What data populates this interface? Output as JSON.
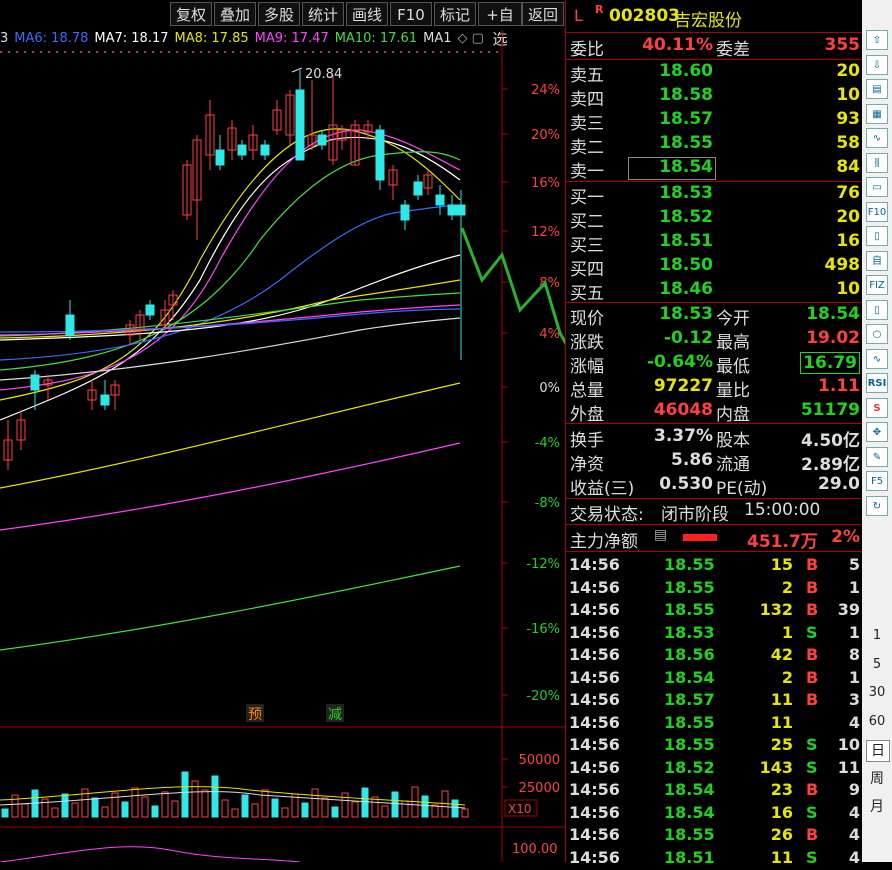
{
  "toolbar": {
    "buttons": [
      "复权",
      "叠加",
      "多股",
      "统计",
      "画线",
      "F10",
      "标记",
      "+自选",
      "返回"
    ]
  },
  "ma_bar": {
    "cut_prefix": "3",
    "items": [
      {
        "label": "MA6: 18.78",
        "color": "#3a6bff"
      },
      {
        "label": "MA7: 18.17",
        "color": "#ffffff"
      },
      {
        "label": "MA8: 17.85",
        "color": "#e6e600"
      },
      {
        "label": "MA9: 17.47",
        "color": "#ff44ff"
      },
      {
        "label": "MA10: 17.61",
        "color": "#44dd44"
      },
      {
        "label": "MA1",
        "color": "#dddddd"
      }
    ]
  },
  "chart": {
    "high_label": "20.84",
    "pct_ticks": [
      "24%",
      "20%",
      "16%",
      "12%",
      "8%",
      "4%",
      "0%",
      "-4%",
      "-8%",
      "-12%",
      "-16%",
      "-20%"
    ],
    "markers": [
      "预",
      "减"
    ],
    "volume_ticks": [
      "50000",
      "25000"
    ],
    "volume_multiplier": "X10",
    "indicator_tick": "100.00"
  },
  "quote": {
    "header": {
      "prefix": "L",
      "badge": "R",
      "code": "002803",
      "name": "吉宏股份"
    },
    "ratio": {
      "label": "委比",
      "value": "40.11%",
      "label2": "委差",
      "value2": "355"
    },
    "asks": [
      {
        "label": "卖五",
        "price": "18.60",
        "vol": "20"
      },
      {
        "label": "卖四",
        "price": "18.58",
        "vol": "10"
      },
      {
        "label": "卖三",
        "price": "18.57",
        "vol": "93"
      },
      {
        "label": "卖二",
        "price": "18.55",
        "vol": "58"
      },
      {
        "label": "卖一",
        "price": "18.54",
        "vol": "84"
      }
    ],
    "bids": [
      {
        "label": "买一",
        "price": "18.53",
        "vol": "76"
      },
      {
        "label": "买二",
        "price": "18.52",
        "vol": "20"
      },
      {
        "label": "买三",
        "price": "18.51",
        "vol": "16"
      },
      {
        "label": "买四",
        "price": "18.50",
        "vol": "498"
      },
      {
        "label": "买五",
        "price": "18.46",
        "vol": "10"
      }
    ],
    "stats": [
      {
        "l1": "现价",
        "v1": "18.53",
        "c1": "g",
        "l2": "今开",
        "v2": "18.54",
        "c2": "g"
      },
      {
        "l1": "涨跌",
        "v1": "-0.12",
        "c1": "g",
        "l2": "最高",
        "v2": "19.02",
        "c2": "r"
      },
      {
        "l1": "涨幅",
        "v1": "-0.64%",
        "c1": "g",
        "l2": "最低",
        "v2": "16.79",
        "c2": "g"
      },
      {
        "l1": "总量",
        "v1": "97227",
        "c1": "y",
        "l2": "量比",
        "v2": "1.11",
        "c2": "r"
      },
      {
        "l1": "外盘",
        "v1": "46048",
        "c1": "r",
        "l2": "内盘",
        "v2": "51179",
        "c2": "g"
      }
    ],
    "fundamentals": [
      {
        "l1": "换手",
        "v1": "3.37%",
        "l2": "股本",
        "v2": "4.50亿"
      },
      {
        "l1": "净资",
        "v1": "5.86",
        "l2": "流通",
        "v2": "2.89亿"
      },
      {
        "l1": "收益(三)",
        "v1": "0.530",
        "l2": "PE(动)",
        "v2": "29.0"
      }
    ],
    "trade_status": {
      "label": "交易状态:",
      "value": "闭市阶段",
      "time": "15:00:00"
    },
    "main_flow": {
      "label": "主力净额",
      "value": "451.7万",
      "pct": "2%"
    },
    "ticks": [
      {
        "t": "14:56",
        "p": "18.55",
        "v": "15",
        "s": "B",
        "n": "5"
      },
      {
        "t": "14:56",
        "p": "18.55",
        "v": "2",
        "s": "B",
        "n": "1"
      },
      {
        "t": "14:56",
        "p": "18.55",
        "v": "132",
        "s": "B",
        "n": "39"
      },
      {
        "t": "14:56",
        "p": "18.53",
        "v": "1",
        "s": "S",
        "n": "1"
      },
      {
        "t": "14:56",
        "p": "18.56",
        "v": "42",
        "s": "B",
        "n": "8"
      },
      {
        "t": "14:56",
        "p": "18.54",
        "v": "2",
        "s": "B",
        "n": "1"
      },
      {
        "t": "14:56",
        "p": "18.57",
        "v": "11",
        "s": "B",
        "n": "3"
      },
      {
        "t": "14:56",
        "p": "18.55",
        "v": "11",
        "s": "",
        "n": "4"
      },
      {
        "t": "14:56",
        "p": "18.55",
        "v": "25",
        "s": "S",
        "n": "10"
      },
      {
        "t": "14:56",
        "p": "18.52",
        "v": "143",
        "s": "S",
        "n": "11"
      },
      {
        "t": "14:56",
        "p": "18.54",
        "v": "23",
        "s": "B",
        "n": "9"
      },
      {
        "t": "14:56",
        "p": "18.54",
        "v": "16",
        "s": "S",
        "n": "4"
      },
      {
        "t": "14:56",
        "p": "18.55",
        "v": "26",
        "s": "B",
        "n": "4"
      },
      {
        "t": "14:56",
        "p": "18.51",
        "v": "11",
        "s": "S",
        "n": "4"
      }
    ]
  },
  "sidebar": {
    "icons": [
      "arrow-up-icon",
      "arrow-down-icon",
      "news-icon",
      "table-icon",
      "line-chart-icon",
      "kline-icon",
      "list-icon",
      "f10-icon",
      "doc-icon",
      "self-select-icon",
      "fz-icon",
      "r-icon",
      "circle-icon",
      "wave-icon",
      "rsi-icon",
      "s-icon",
      "move-icon",
      "pen-icon",
      "f5-icon",
      "refresh-icon"
    ],
    "icon_text": [
      "",
      "",
      "",
      "",
      "",
      "",
      "",
      "F10",
      "",
      "自",
      "FIZ",
      "",
      "",
      "",
      "RSI",
      "S",
      "",
      "",
      "F5",
      ""
    ],
    "periods": [
      "1",
      "5",
      "30",
      "60",
      "日",
      "周",
      "月"
    ]
  }
}
